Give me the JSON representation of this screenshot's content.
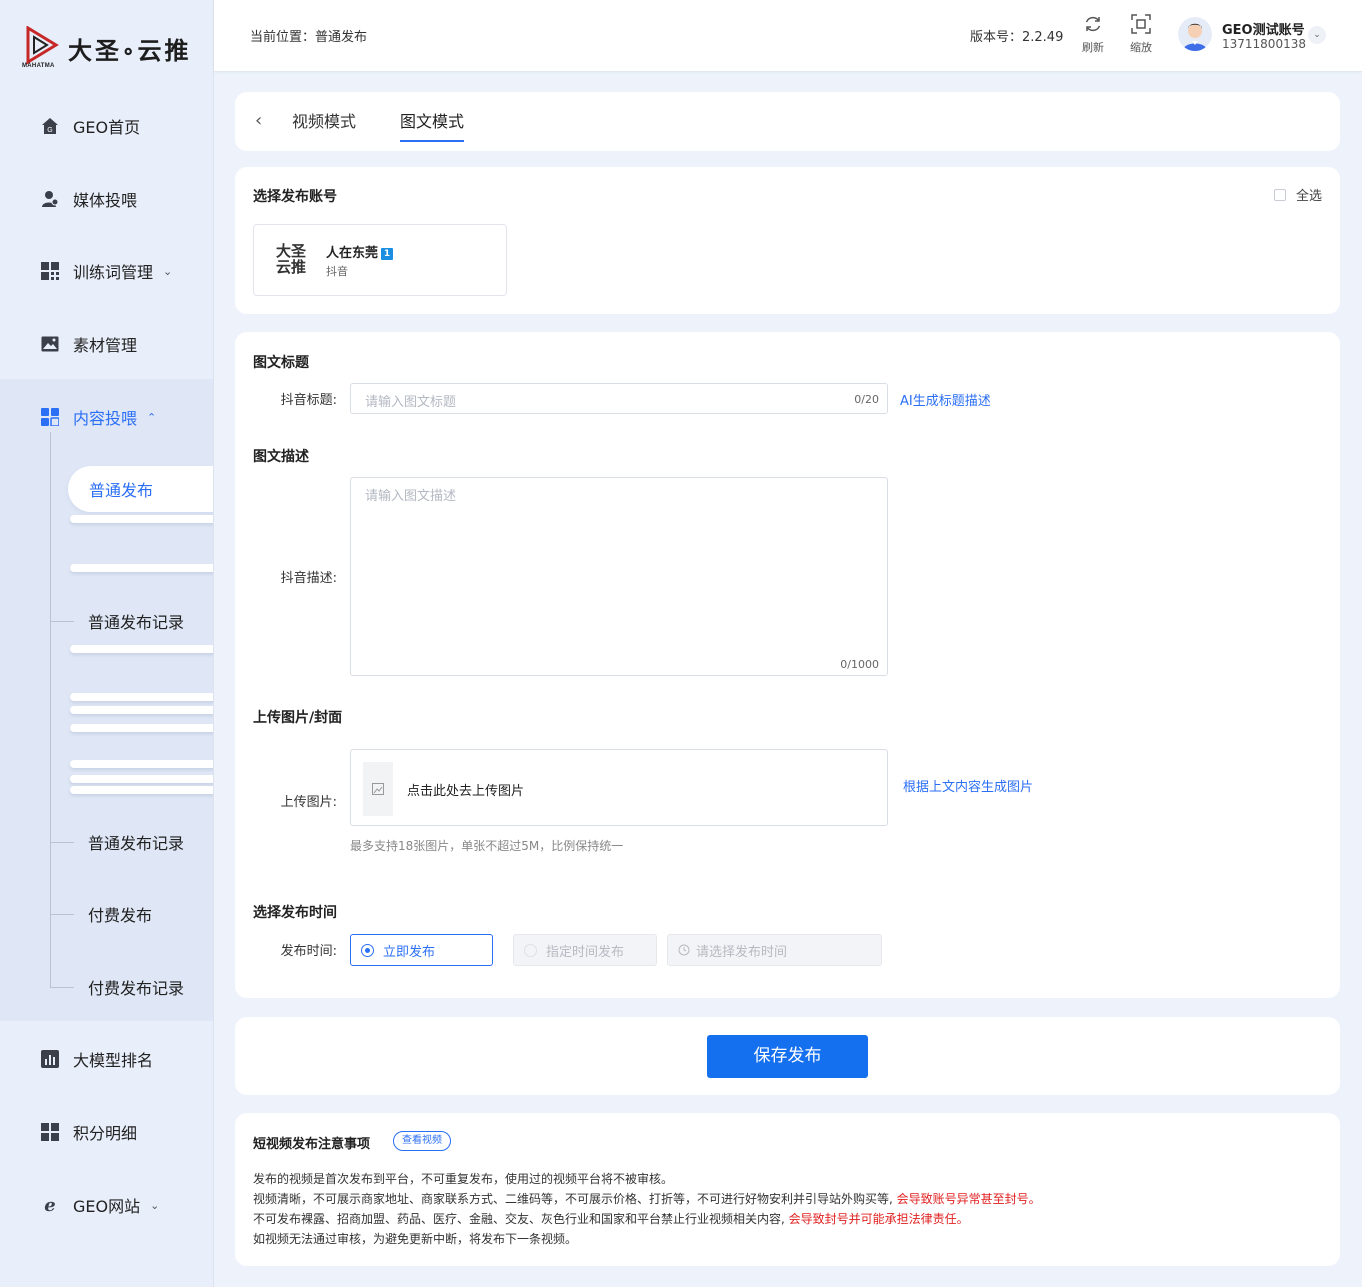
{
  "brand": {
    "name": "大圣∘云推",
    "sub": "MAHATMA"
  },
  "sidebar": {
    "items": [
      {
        "label": "GEO首页",
        "icon": "home-icon"
      },
      {
        "label": "媒体投喂",
        "icon": "user-icon"
      },
      {
        "label": "训练词管理",
        "icon": "grid-icon"
      },
      {
        "label": "素材管理",
        "icon": "image-icon"
      },
      {
        "label": "内容投喂",
        "icon": "grid-icon"
      },
      {
        "label": "大模型排名",
        "icon": "chart-icon"
      },
      {
        "label": "积分明细",
        "icon": "grid-icon"
      },
      {
        "label": "GEO网站",
        "icon": "ie-icon"
      }
    ],
    "sub_items": [
      {
        "label": "普通发布"
      },
      {
        "label": "普通发布记录"
      },
      {
        "label": "普通发布记录"
      },
      {
        "label": "付费发布"
      },
      {
        "label": "付费发布记录"
      }
    ]
  },
  "header": {
    "breadcrumb": "当前位置：普通发布",
    "version": "版本号：2.2.49",
    "refresh": "刷新",
    "zoom": "缩放",
    "user_name": "GEO测试账号",
    "user_phone": "13711800138"
  },
  "tabs": [
    {
      "label": "视频模式",
      "active": false
    },
    {
      "label": "图文模式",
      "active": true
    }
  ],
  "account_section": {
    "title": "选择发布账号",
    "select_all": "全选",
    "account": {
      "logo_text": "大圣云推",
      "name": "人在东莞",
      "badge": "1",
      "platform": "抖音"
    }
  },
  "form": {
    "title_section": "图文标题",
    "title_label": "抖音标题:",
    "title_placeholder": "请输入图文标题",
    "title_counter": "0/20",
    "ai_title_link": "AI生成标题描述",
    "desc_section": "图文描述",
    "desc_label": "抖音描述:",
    "desc_placeholder": "请输入图文描述",
    "desc_counter": "0/1000",
    "upload_section": "上传图片/封面",
    "upload_label": "上传图片:",
    "upload_text": "点击此处去上传图片",
    "generate_link": "根据上文内容生成图片",
    "upload_hint": "最多支持18张图片，单张不超过5M，比例保持统一",
    "time_section": "选择发布时间",
    "time_label": "发布时间:",
    "option_now": "立即发布",
    "option_scheduled": "指定时间发布",
    "time_placeholder": "请选择发布时间"
  },
  "save_button": "保存发布",
  "notes": {
    "title": "短视频发布注意事项",
    "view_video": "查看视频",
    "line1": "发布的视频是首次发布到平台，不可重复发布，使用过的视频平台将不被审核。",
    "line2": "视频清晰，不可展示商家地址、商家联系方式、二维码等，不可展示价格、打折等，不可进行好物安利并引导站外购买等,",
    "line2_warn": "会导致账号异常甚至封号。",
    "line3": "不可发布裸露、招商加盟、药品、医疗、金融、交友、灰色行业和国家和平台禁止行业视频相关内容,",
    "line3_warn": "会导致封号并可能承担法律责任。",
    "line4": "如视频无法通过审核，为避免更新中断，将发布下一条视频。"
  },
  "colors": {
    "accent": "#2b6ff5",
    "button": "#1570ef",
    "warn": "#e02020",
    "background": "#eef3fb"
  }
}
